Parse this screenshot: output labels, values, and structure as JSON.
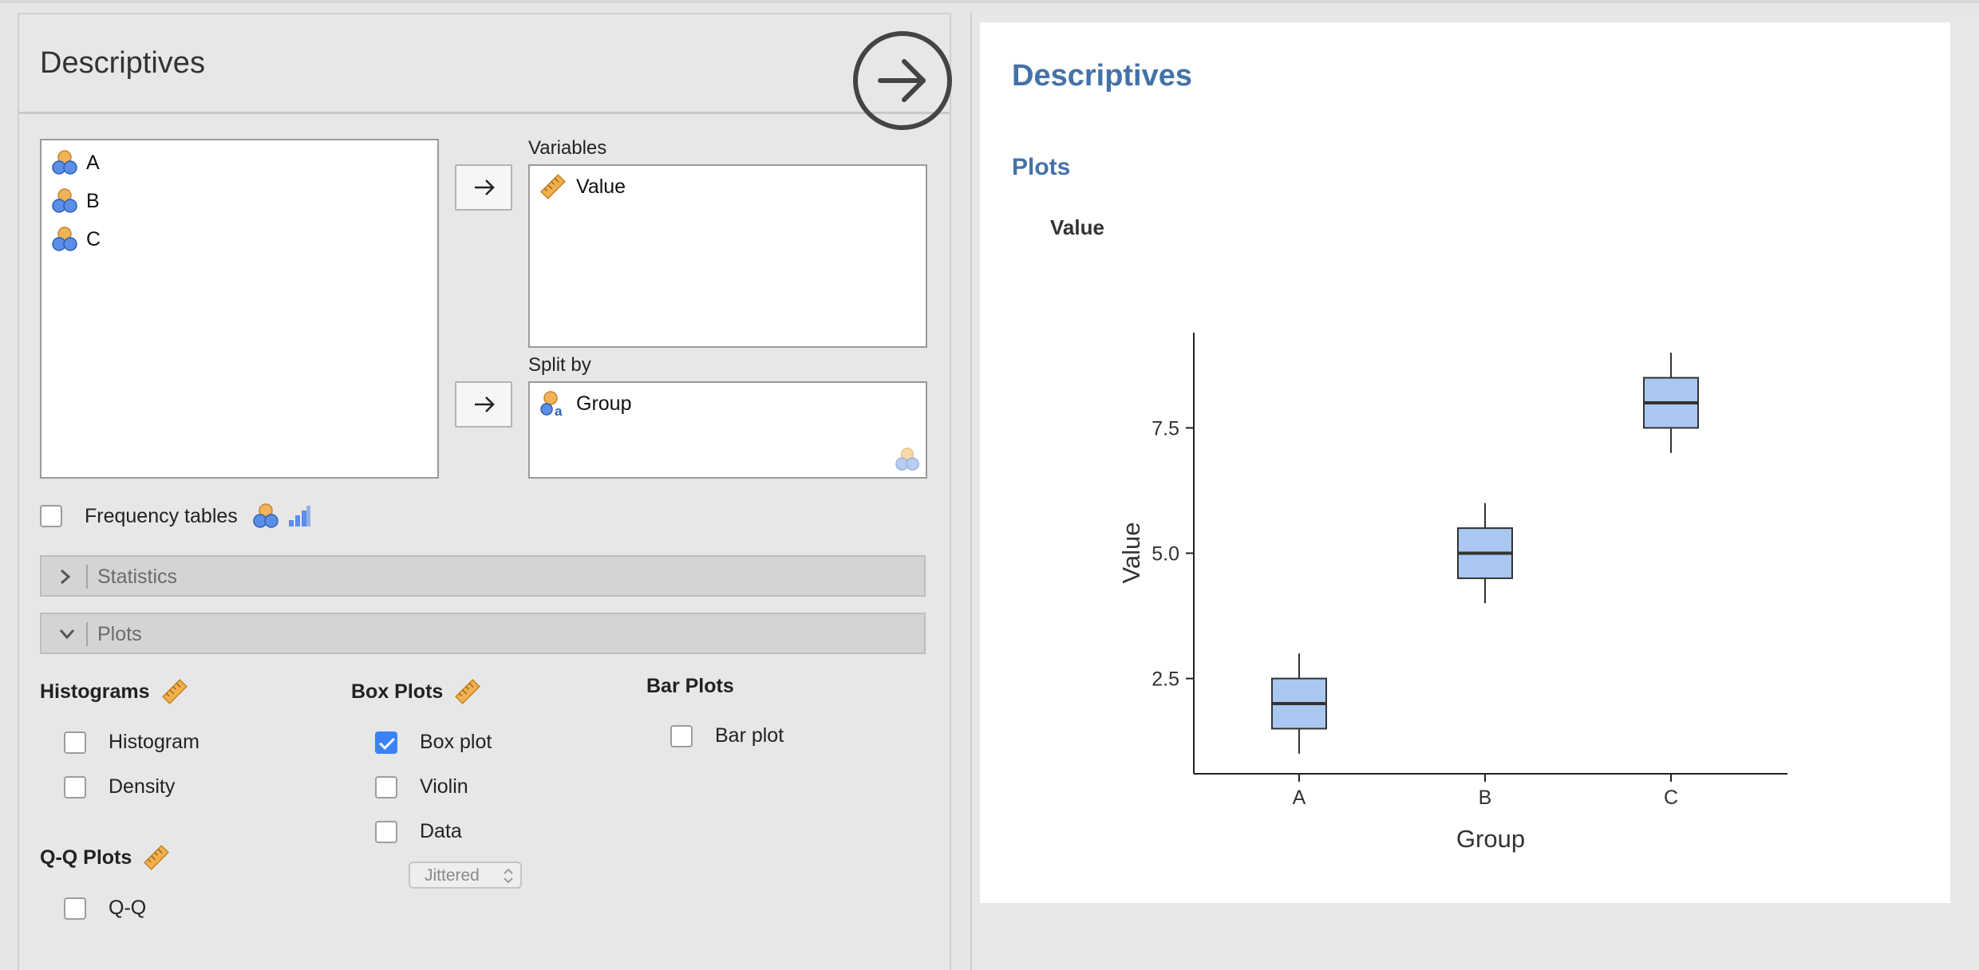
{
  "options": {
    "title": "Descriptives",
    "source_variables": [
      "A",
      "B",
      "C"
    ],
    "variables_label": "Variables",
    "variables": [
      "Value"
    ],
    "split_by_label": "Split by",
    "split_by": [
      "Group"
    ],
    "frequency_tables_label": "Frequency tables",
    "frequency_tables_checked": false,
    "sections": {
      "statistics": "Statistics",
      "plots": "Plots"
    },
    "histograms": {
      "heading": "Histograms",
      "histogram": "Histogram",
      "density": "Density"
    },
    "box_plots": {
      "heading": "Box Plots",
      "box_plot": "Box plot",
      "violin": "Violin",
      "data": "Data",
      "data_style": "Jittered"
    },
    "bar_plots": {
      "heading": "Bar Plots",
      "bar_plot": "Bar plot"
    },
    "qq_plots": {
      "heading": "Q-Q Plots",
      "qq": "Q-Q"
    }
  },
  "results": {
    "title": "Descriptives",
    "subtitle": "Plots",
    "variable_heading": "Value"
  },
  "colors": {
    "accent": "#4472a8",
    "checkbox_on": "#3b82f6",
    "box_fill": "#a9c7f0",
    "box_stroke": "#333333",
    "ruler": "#f2b04c",
    "nominal_orange": "#f0b35a",
    "nominal_blue": "#5b8ee6"
  },
  "chart_data": {
    "type": "boxplot",
    "xlabel": "Group",
    "ylabel": "Value",
    "categories": [
      "A",
      "B",
      "C"
    ],
    "yticks": [
      2.5,
      5.0,
      7.5
    ],
    "ytick_labels": [
      "2.5",
      "5.0",
      "7.5"
    ],
    "ylim": [
      0.6,
      9.4
    ],
    "boxes": [
      {
        "category": "A",
        "whisker_low": 1.0,
        "q1": 1.5,
        "median": 2.0,
        "q3": 2.5,
        "whisker_high": 3.0
      },
      {
        "category": "B",
        "whisker_low": 4.0,
        "q1": 4.5,
        "median": 5.0,
        "q3": 5.5,
        "whisker_high": 6.0
      },
      {
        "category": "C",
        "whisker_low": 7.0,
        "q1": 7.5,
        "median": 8.0,
        "q3": 8.5,
        "whisker_high": 9.0
      }
    ]
  }
}
